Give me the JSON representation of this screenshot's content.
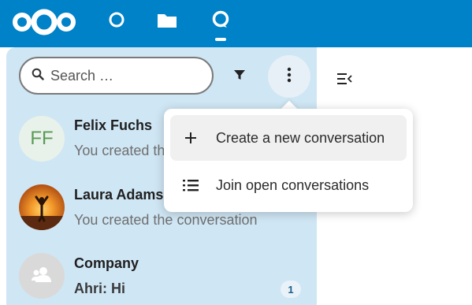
{
  "topbar": {
    "logo": "nextcloud-logo",
    "apps": [
      {
        "name": "dashboard",
        "icon": "circle-icon"
      },
      {
        "name": "files",
        "icon": "folder-icon"
      },
      {
        "name": "talk",
        "icon": "talk-icon",
        "active": true
      }
    ],
    "color": "#0082c9"
  },
  "search": {
    "placeholder": "Search …"
  },
  "conversations": [
    {
      "name": "Felix Fuchs",
      "avatar_initials": "FF",
      "last_message": "You created the conversation"
    },
    {
      "name": "Laura Adams",
      "avatar": "photo",
      "last_message": "You created the conversation"
    },
    {
      "name": "Company",
      "avatar": "group-icon",
      "last_message": "Ahri: Hi",
      "unread": "1"
    }
  ],
  "menu": {
    "items": [
      {
        "label": "Create a new conversation",
        "icon": "plus-icon"
      },
      {
        "label": "Join open conversations",
        "icon": "list-icon"
      }
    ]
  },
  "colors": {
    "sidebar_bg": "#cfe6f4",
    "accent": "#0082c9"
  }
}
